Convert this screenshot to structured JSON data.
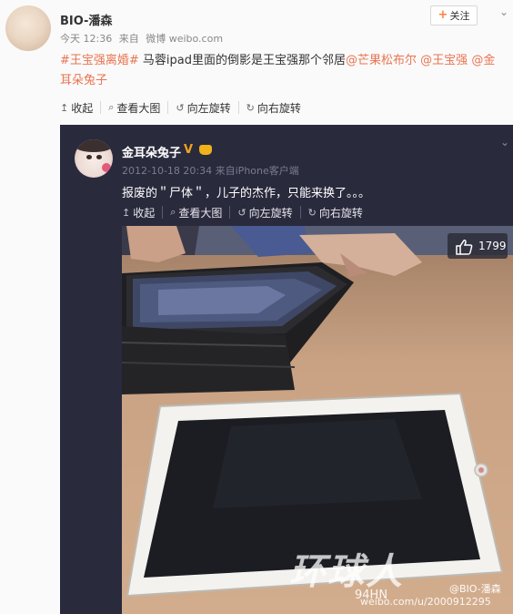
{
  "post": {
    "author": "BIO-潘森",
    "time": "今天 12:36",
    "source_prefix": "来自",
    "source": "微博 weibo.com",
    "follow_label": "关注",
    "text_topic": "#王宝强离婚#",
    "text_body": " 马蓉ipad里面的倒影是王宝强那个邻居",
    "mention_1": "@芒果松布尔",
    "mention_2": "@王宝强",
    "mention_3": "@金耳朵兔子",
    "toolbar": {
      "collapse": "收起",
      "view_large": "查看大图",
      "rotate_left": "向左旋转",
      "rotate_right": "向右旋转"
    }
  },
  "repost": {
    "author": "金耳朵兔子",
    "verified_badge": "V",
    "time": "2012-10-18 20:34",
    "source_prefix": "来自",
    "source": "iPhone客户端",
    "text": "报废的＂尸体＂，儿子的杰作，只能来换了。。。",
    "toolbar": {
      "collapse": "收起",
      "view_large": "查看大图",
      "rotate_left": "向左旋转",
      "rotate_right": "向右旋转"
    },
    "like_count": "1799"
  },
  "watermark": {
    "big": "环球人",
    "sub": "94HN",
    "at": "@BIO-潘森",
    "url": "weibo.com/u/2000912295"
  },
  "colors": {
    "accent_link": "#eb7350",
    "repost_bg": "#2a2a3d",
    "follow_plus": "#ff8140"
  },
  "icons": [
    "plus-icon",
    "chevron-down-icon",
    "collapse-arrow-icon",
    "search-icon",
    "rotate-left-icon",
    "rotate-right-icon",
    "thumbs-up-icon",
    "vip-crown-icon"
  ]
}
